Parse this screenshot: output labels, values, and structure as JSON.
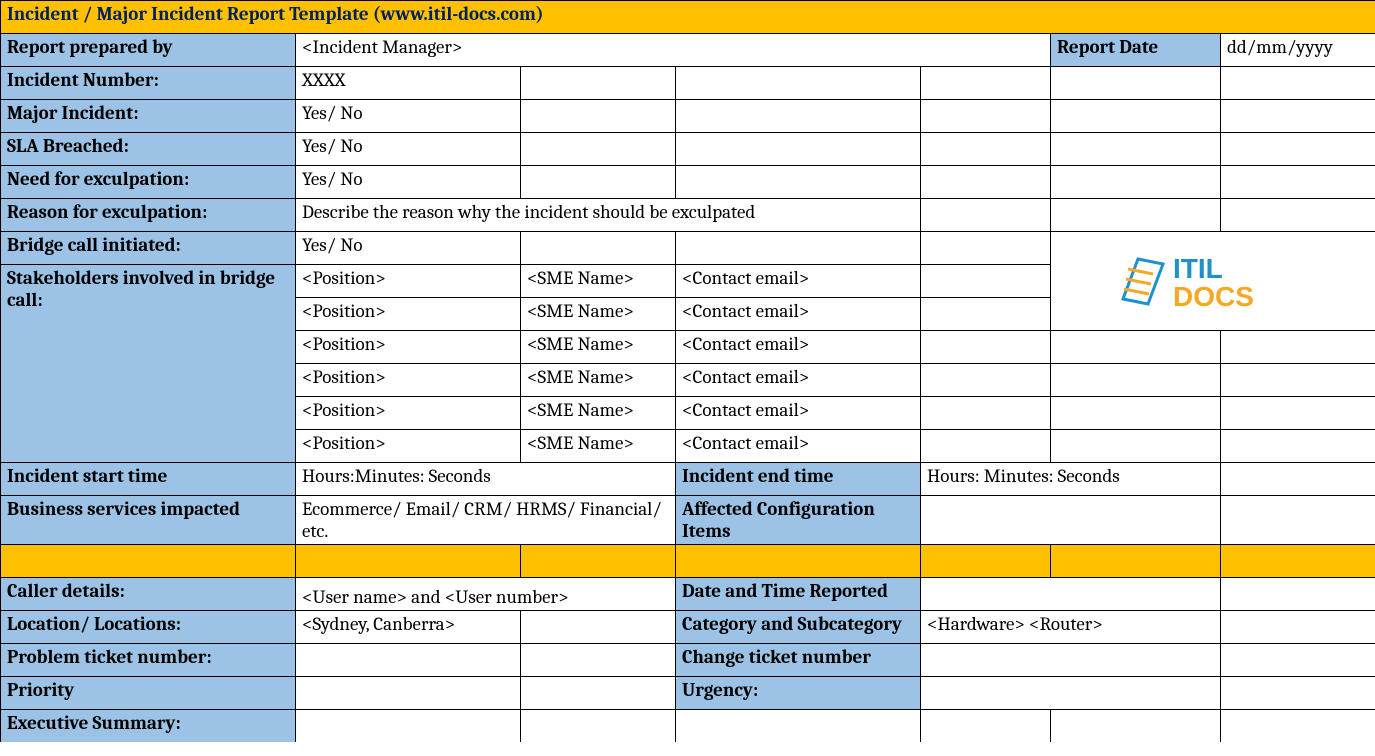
{
  "title": "Incident / Major Incident Report Template   (www.itil-docs.com)",
  "labels": {
    "prepared_by": "Report prepared by",
    "report_date": "Report Date",
    "incident_number": "Incident Number:",
    "major_incident": "Major Incident:",
    "sla_breached": "SLA Breached:",
    "need_exculpation": "Need for exculpation:",
    "reason_exculpation": "Reason for exculpation:",
    "bridge_call": "Bridge call initiated:",
    "stakeholders": "Stakeholders involved in bridge call:",
    "incident_start": "Incident start time",
    "incident_end": "Incident end time",
    "biz_services": "Business services impacted",
    "affected_ci": "Affected Configuration Items",
    "caller_details": "Caller details:",
    "date_time_reported": "Date and Time Reported",
    "location": "Location/ Locations:",
    "category_subcat": "Category and Subcategory",
    "problem_ticket": "Problem ticket number:",
    "change_ticket": "Change ticket number",
    "priority": "Priority",
    "urgency": "Urgency:",
    "exec_summary": "Executive Summary:"
  },
  "values": {
    "prepared_by": "<Incident Manager>",
    "report_date": "dd/mm/yyyy",
    "incident_number": "XXXX",
    "major_incident": "Yes/ No",
    "sla_breached": "Yes/ No",
    "need_exculpation": "Yes/ No",
    "reason_exculpation": "Describe the reason why the incident should be exculpated",
    "bridge_call": "Yes/ No",
    "incident_start": "Hours:Minutes: Seconds",
    "incident_end": "Hours: Minutes: Seconds",
    "biz_services": "Ecommerce/ Email/ CRM/ HRMS/ Financial/ etc.",
    "caller_details": "<User name> and <User number>",
    "location": "<Sydney, Canberra>",
    "category_subcat": "<Hardware> <Router>"
  },
  "stakeholders": [
    {
      "position": "<Position>",
      "sme": "<SME Name>",
      "email": "<Contact email>"
    },
    {
      "position": "<Position>",
      "sme": "<SME Name>",
      "email": "<Contact email>"
    },
    {
      "position": "<Position>",
      "sme": "<SME Name>",
      "email": "<Contact email>"
    },
    {
      "position": "<Position>",
      "sme": "<SME Name>",
      "email": "<Contact email>"
    },
    {
      "position": "<Position>",
      "sme": "<SME Name>",
      "email": "<Contact email>"
    },
    {
      "position": "<Position>",
      "sme": "<SME Name>",
      "email": "<Contact email>"
    }
  ],
  "logo": {
    "text1": "ITIL",
    "text2": "DOCS"
  }
}
